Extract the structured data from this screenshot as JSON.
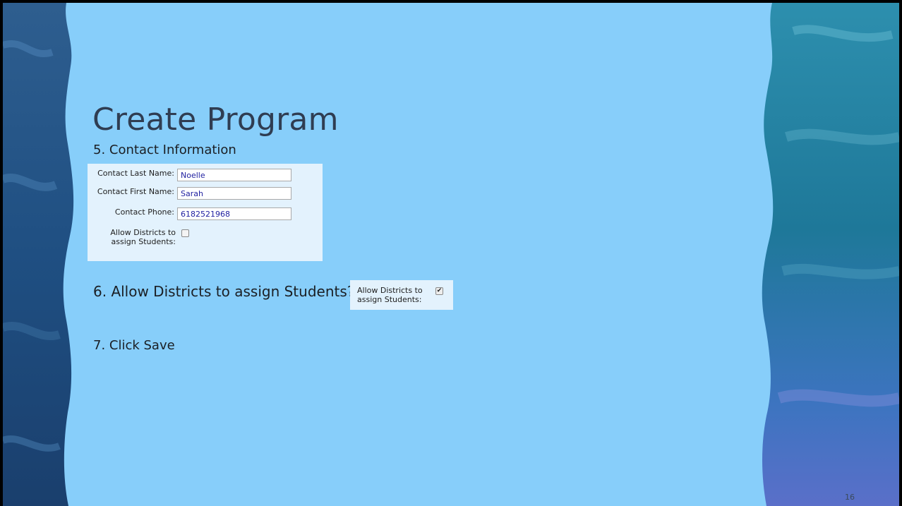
{
  "slide": {
    "title": "Create Program",
    "step5": "5.  Contact Information",
    "step6": "6.  Allow Districts to assign Students?",
    "step7": "7.  Click Save",
    "page_number": "16"
  },
  "contact_form": {
    "last_name_label": "Contact Last Name:",
    "last_name_value": "Noelle",
    "first_name_label": "Contact First Name:",
    "first_name_value": "Sarah",
    "phone_label": "Contact Phone:",
    "phone_value": "6182521968",
    "allow_label_line1": "Allow Districts to",
    "allow_label_line2": "assign Students:",
    "allow_checked": false
  },
  "allow_example": {
    "label_line1": "Allow Districts to",
    "label_line2": "assign Students:",
    "checked": true
  },
  "colors": {
    "background": "#87cefa",
    "title": "#2f3d52",
    "panel": "#e3f2fd",
    "input_text": "#1f1fa0"
  }
}
